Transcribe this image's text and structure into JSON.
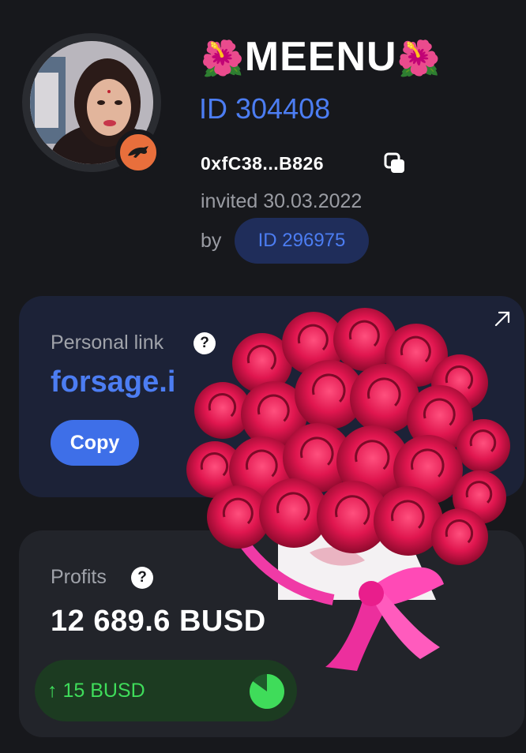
{
  "profile": {
    "name": "MEENU",
    "name_flower_left": "🌺",
    "name_flower_right": "🌺",
    "id": "ID 304408",
    "wallet": "0xfC38...B826",
    "invited": "invited 30.03.2022",
    "by_label": "by",
    "referrer_id": "ID 296975",
    "badge_icon": "panther-icon",
    "badge_color": "#e86f3c"
  },
  "personal_link": {
    "label": "Personal link",
    "help": "?",
    "link_text": "forsage.i",
    "copy_label": "Copy",
    "external_icon": "external-link-icon"
  },
  "profits": {
    "label": "Profits",
    "help": "?",
    "value": "12 689.6 BUSD",
    "gain_arrow": "↑",
    "gain_value": "15 BUSD",
    "gain_progress": 0.85,
    "gain_color": "#3fdc5a"
  },
  "colors": {
    "accent": "#4c7df2",
    "background": "#17181c",
    "link_card": "#1c2237",
    "profit_card": "#22242a"
  }
}
